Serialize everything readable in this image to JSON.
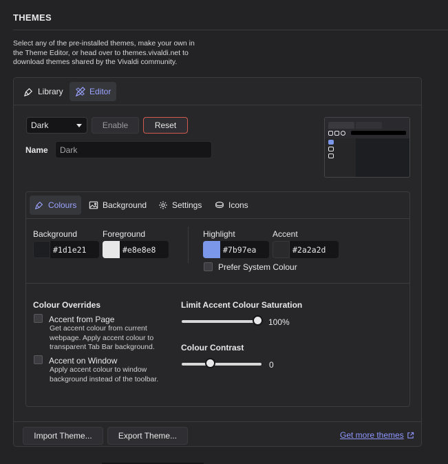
{
  "section": {
    "title": "THEMES",
    "intro": "Select any of the pre-installed themes, make your own in the Theme Editor, or head over to themes.vivaldi.net to download themes shared by the Vivaldi community."
  },
  "panel_tabs": [
    {
      "label": "Library",
      "icon": "brush-icon",
      "active": false
    },
    {
      "label": "Editor",
      "icon": "pencil-ruler-icon",
      "active": true
    }
  ],
  "editor": {
    "theme_select": "Dark",
    "enable_label": "Enable",
    "reset_label": "Reset",
    "name_label": "Name",
    "name_value": "Dark"
  },
  "inner_tabs": [
    {
      "label": "Colours",
      "icon": "brush-icon",
      "active": true
    },
    {
      "label": "Background",
      "icon": "image-icon",
      "active": false
    },
    {
      "label": "Settings",
      "icon": "gear-icon",
      "active": false
    },
    {
      "label": "Icons",
      "icon": "icons-stack-icon",
      "active": false
    }
  ],
  "colours": {
    "background": {
      "label": "Background",
      "value": "#1d1e21",
      "chip": "#1d1e21"
    },
    "foreground": {
      "label": "Foreground",
      "value": "#e8e8e8",
      "chip": "#e8e8e8"
    },
    "highlight": {
      "label": "Highlight",
      "value": "#7b97ea",
      "chip": "#7b97ea"
    },
    "accent": {
      "label": "Accent",
      "value": "#2a2a2d",
      "chip": "#2a2a2d"
    },
    "prefer_system": "Prefer System Colour"
  },
  "overrides": {
    "title": "Colour Overrides",
    "accent_from_page": {
      "label": "Accent from Page",
      "desc": "Get accent colour from current webpage. Apply accent colour to transparent Tab Bar background."
    },
    "accent_on_window": {
      "label": "Accent on Window",
      "desc": "Apply accent colour to window background instead of the toolbar."
    }
  },
  "saturation": {
    "title": "Limit Accent Colour Saturation",
    "value_text": "100%",
    "fraction": 1.0
  },
  "contrast": {
    "title": "Colour Contrast",
    "value_text": "0",
    "fraction": 0.36
  },
  "footer": {
    "import_label": "Import Theme...",
    "export_label": "Export Theme...",
    "more_link": "Get more themes"
  }
}
